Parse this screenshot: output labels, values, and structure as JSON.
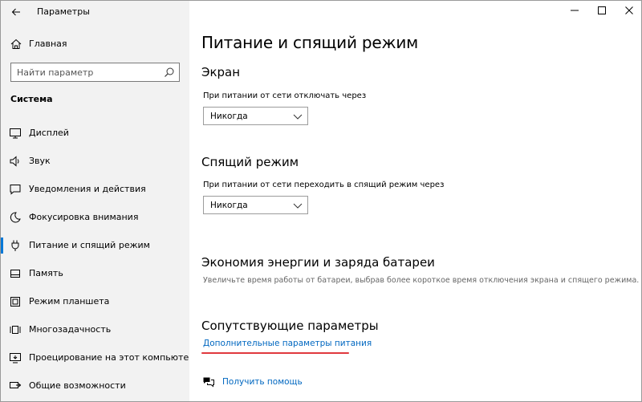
{
  "app": {
    "title": "Параметры"
  },
  "sidebar": {
    "home_label": "Главная",
    "search_placeholder": "Найти параметр",
    "section_label": "Система",
    "items": [
      {
        "label": "Дисплей",
        "icon": "monitor-icon",
        "active": false
      },
      {
        "label": "Звук",
        "icon": "speaker-icon",
        "active": false
      },
      {
        "label": "Уведомления и действия",
        "icon": "notification-icon",
        "active": false
      },
      {
        "label": "Фокусировка внимания",
        "icon": "moon-icon",
        "active": false
      },
      {
        "label": "Питание и спящий режим",
        "icon": "power-icon",
        "active": true
      },
      {
        "label": "Память",
        "icon": "storage-icon",
        "active": false
      },
      {
        "label": "Режим планшета",
        "icon": "tablet-icon",
        "active": false
      },
      {
        "label": "Многозадачность",
        "icon": "multitasking-icon",
        "active": false
      },
      {
        "label": "Проецирование на этот компьютер",
        "icon": "projection-icon",
        "active": false
      },
      {
        "label": "Общие возможности",
        "icon": "shared-experiences-icon",
        "active": false
      }
    ]
  },
  "main": {
    "title": "Питание и спящий режим",
    "screen": {
      "heading": "Экран",
      "caption": "При питании от сети отключать через",
      "value": "Никогда"
    },
    "sleep": {
      "heading": "Спящий режим",
      "caption": "При питании от сети переходить в спящий режим через",
      "value": "Никогда"
    },
    "battery": {
      "heading": "Экономия энергии и заряда батареи",
      "description": "Увеличьте время работы от батареи, выбрав более короткое время отключения экрана и спящего режима."
    },
    "related": {
      "heading": "Сопутствующие параметры",
      "link": "Дополнительные параметры питания"
    },
    "help_link": "Получить помощь"
  },
  "colors": {
    "accent": "#0078d7",
    "link": "#0067c0",
    "highlight": "#e0383e",
    "sidebar_bg": "#f2f2f2"
  }
}
